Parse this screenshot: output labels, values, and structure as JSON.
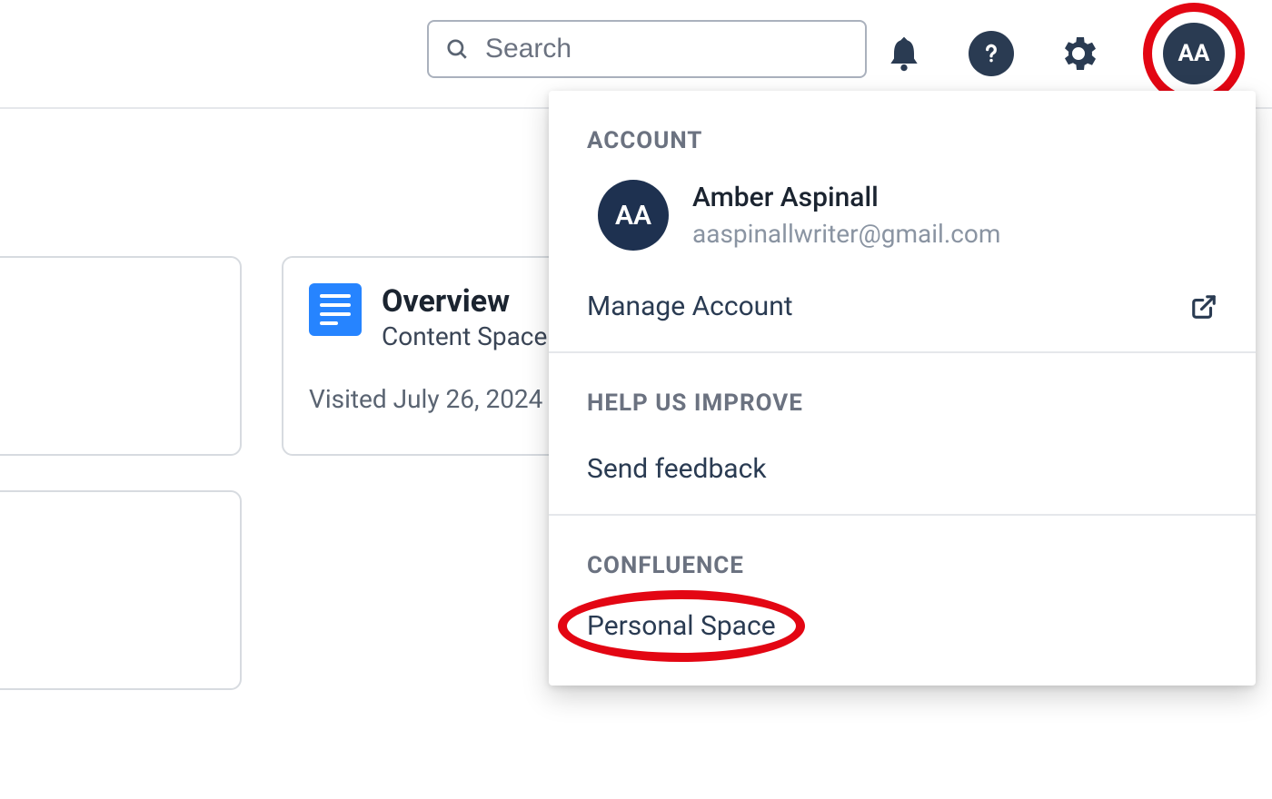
{
  "colors": {
    "brand_navy": "#2a3b52",
    "accent_red": "#e30613",
    "accent_blue": "#2684ff"
  },
  "topbar": {
    "search_placeholder": "Search",
    "avatar_initials": "AA"
  },
  "cards": {
    "overview": {
      "title": "Overview",
      "subtitle": "Content Space",
      "visited": "Visited July 26, 2024"
    }
  },
  "dropdown": {
    "sections": {
      "account": "ACCOUNT",
      "improve": "HELP US IMPROVE",
      "confluence": "CONFLUENCE"
    },
    "user": {
      "initials": "AA",
      "name": "Amber Aspinall",
      "email": "aaspinallwriter@gmail.com"
    },
    "items": {
      "manage_account": "Manage Account",
      "send_feedback": "Send feedback",
      "personal_space": "Personal Space"
    }
  }
}
